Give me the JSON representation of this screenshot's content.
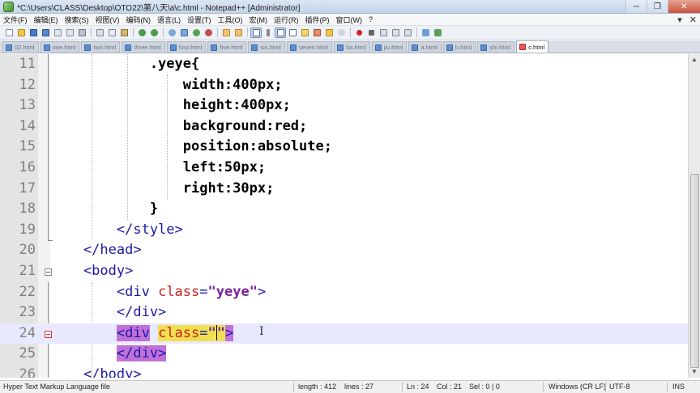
{
  "window": {
    "title": "*C:\\Users\\CLASS\\Desktop\\OTO22\\第八天\\a\\c.html - Notepad++ [Administrator]",
    "minimize": "─",
    "restore": "❐",
    "close": "✕"
  },
  "menu": {
    "items": [
      "文件(F)",
      "编辑(E)",
      "搜索(S)",
      "视图(V)",
      "编码(N)",
      "语言(L)",
      "设置(T)",
      "工具(O)",
      "宏(M)",
      "运行(R)",
      "插件(P)",
      "窗口(W)",
      "?"
    ],
    "right_buttons": [
      "▾",
      "✕"
    ]
  },
  "toolbar": {
    "icons": [
      "new-file-icon",
      "open-file-icon",
      "save-icon",
      "save-all-icon",
      "close-icon",
      "close-all-icon",
      "print-icon",
      "cut-icon",
      "copy-icon",
      "paste-icon",
      "undo-icon",
      "redo-icon",
      "find-icon",
      "replace-icon",
      "zoom-in-icon",
      "zoom-out-icon",
      "sync-v-icon",
      "sync-h-icon",
      "wrap-icon",
      "all-chars-icon",
      "indent-guide-icon",
      "lang-icon",
      "doc-map-icon",
      "func-list-icon",
      "folder-icon",
      "monitor-icon",
      "record-icon",
      "stop-icon",
      "play-icon",
      "play-multi-icon",
      "save-macro-icon",
      "spell-icon",
      "run-icon"
    ]
  },
  "tabs": [
    {
      "label": "02.html",
      "active": false
    },
    {
      "label": "one.html",
      "active": false
    },
    {
      "label": "two.html",
      "active": false
    },
    {
      "label": "three.html",
      "active": false
    },
    {
      "label": "four.html",
      "active": false
    },
    {
      "label": "five.html",
      "active": false
    },
    {
      "label": "six.html",
      "active": false
    },
    {
      "label": "seven.html",
      "active": false
    },
    {
      "label": "ba.html",
      "active": false
    },
    {
      "label": "jiu.html",
      "active": false
    },
    {
      "label": "a.html",
      "active": false
    },
    {
      "label": "b.html",
      "active": false
    },
    {
      "label": "shi.html",
      "active": false
    },
    {
      "label": "c.html",
      "active": true
    }
  ],
  "editor": {
    "lines": [
      {
        "n": "11",
        "text": "            .yeye{"
      },
      {
        "n": "12",
        "text": "                width:400px;"
      },
      {
        "n": "13",
        "text": "                height:400px;"
      },
      {
        "n": "14",
        "text": "                background:red;"
      },
      {
        "n": "15",
        "text": "                position:absolute;"
      },
      {
        "n": "16",
        "text": "                left:50px;"
      },
      {
        "n": "17",
        "text": "                right:30px;"
      },
      {
        "n": "18",
        "text": "            }"
      },
      {
        "n": "19",
        "text": "        </style>"
      },
      {
        "n": "20",
        "text": "    </head>"
      },
      {
        "n": "21",
        "text": "    <body>"
      },
      {
        "n": "22",
        "text": "        <div class=\"yeye\">"
      },
      {
        "n": "23",
        "text": "        </div>"
      },
      {
        "n": "24",
        "text": "        <div class=\"\">"
      },
      {
        "n": "25",
        "text": "        </div>"
      },
      {
        "n": "26",
        "text": "    </body>"
      }
    ],
    "current_line": "24"
  },
  "status": {
    "language": "Hyper Text Markup Language file",
    "length": "length : 412",
    "lines": "lines : 27",
    "ln": "Ln : 24",
    "col": "Col : 21",
    "sel": "Sel : 0 | 0",
    "eol": "Windows (CR LF)",
    "encoding": "UTF-8",
    "mode": "INS"
  }
}
